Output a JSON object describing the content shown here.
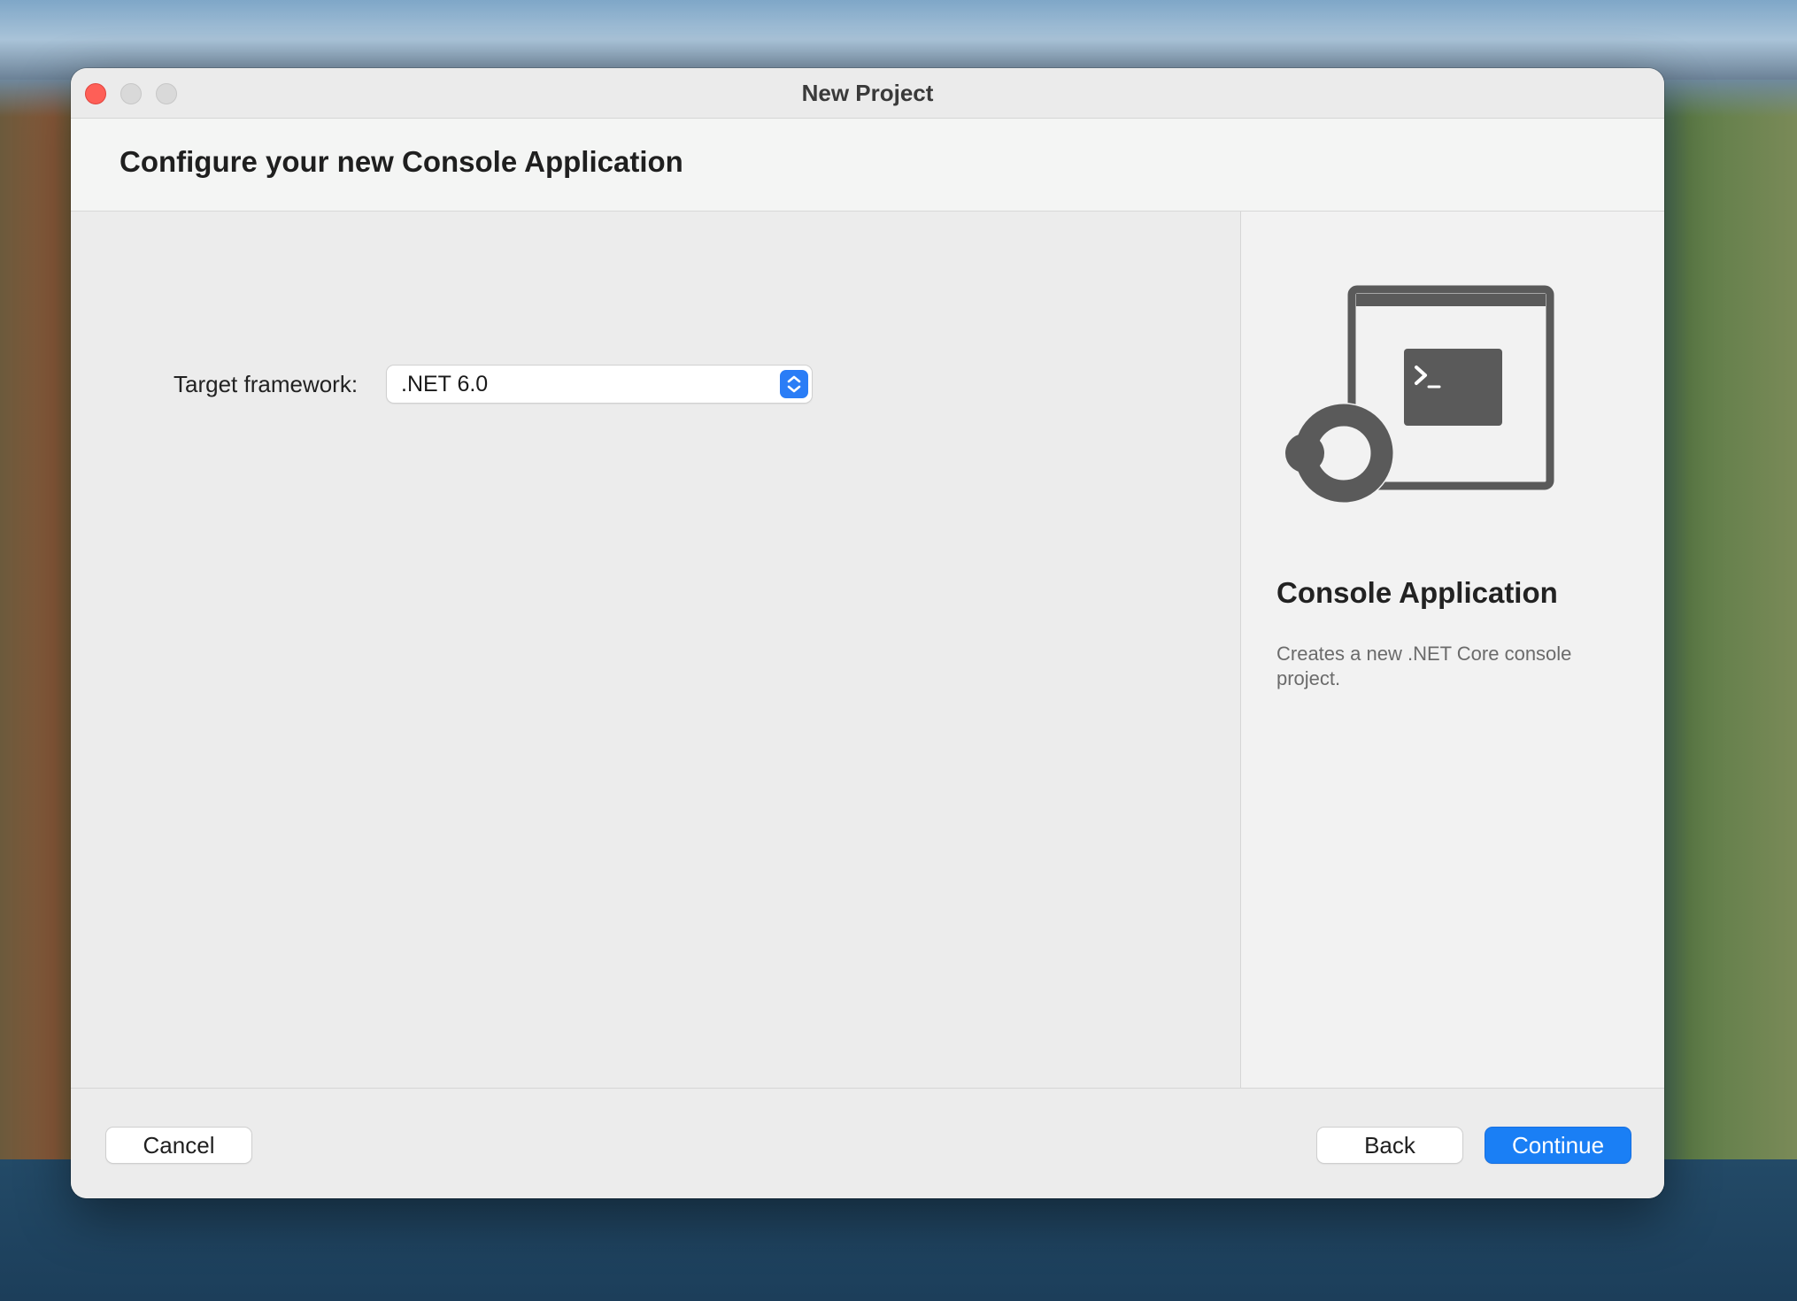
{
  "window": {
    "title": "New Project"
  },
  "header": {
    "title": "Configure your new Console Application"
  },
  "form": {
    "target_framework_label": "Target framework:",
    "target_framework_value": ".NET 6.0"
  },
  "side_panel": {
    "template_name": "Console Application",
    "template_description": "Creates a new .NET Core console project.",
    "illustration_icon": "console-application-icon"
  },
  "footer": {
    "cancel_label": "Cancel",
    "back_label": "Back",
    "continue_label": "Continue"
  },
  "colors": {
    "accent": "#1a7ff5",
    "close": "#fe5f57",
    "icon_gray": "#5a5a5a"
  }
}
